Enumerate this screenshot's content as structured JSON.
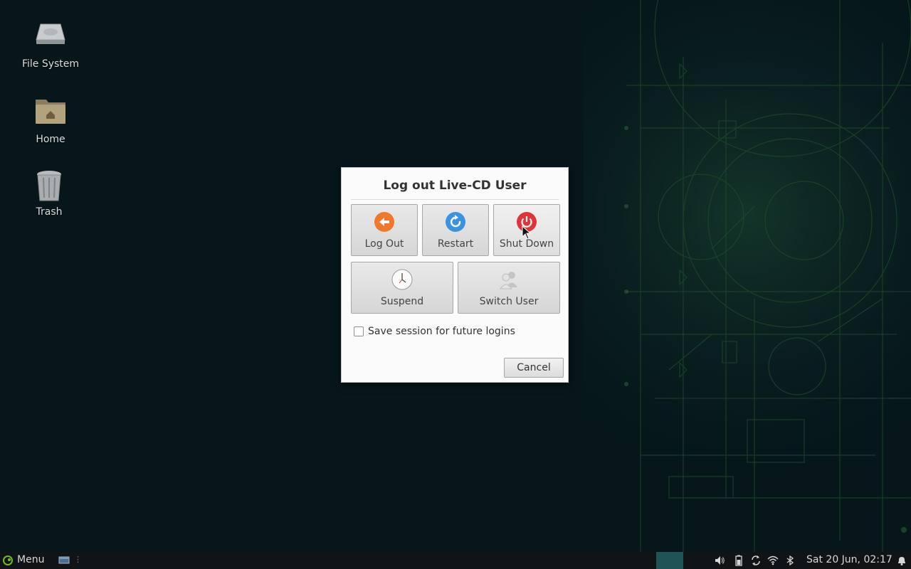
{
  "desktop": {
    "icons": [
      {
        "label": "File System",
        "icon": "drive-harddisk-icon"
      },
      {
        "label": "Home",
        "icon": "home-folder-icon"
      },
      {
        "label": "Trash",
        "icon": "trash-icon"
      }
    ]
  },
  "dialog": {
    "title": "Log out Live-CD User",
    "actions": [
      {
        "label": "Log Out",
        "icon": "logout-arrow-icon",
        "color": "#f0782a"
      },
      {
        "label": "Restart",
        "icon": "restart-icon",
        "color": "#3b93e0"
      },
      {
        "label": "Shut Down",
        "icon": "power-icon",
        "color": "#e0343a"
      },
      {
        "label": "Suspend",
        "icon": "clock-icon",
        "color": "#ffffff"
      },
      {
        "label": "Switch User",
        "icon": "users-icon",
        "color": "#cfcfcf"
      }
    ],
    "save_session": {
      "label": "Save session for future logins",
      "checked": false
    },
    "cancel_label": "Cancel"
  },
  "taskbar": {
    "menu_label": "Menu",
    "clock": "Sat 20 Jun, 02:17",
    "workspace_color": "#1f5355",
    "tray_icons": [
      "volume-icon",
      "battery-icon",
      "update-icon",
      "wifi-icon",
      "bluetooth-icon",
      "notification-bell-icon"
    ]
  },
  "colors": {
    "desktop_bg": "#06161b",
    "taskbar_bg": "#111417",
    "wallpaper_lines": "#1f4a2a"
  }
}
